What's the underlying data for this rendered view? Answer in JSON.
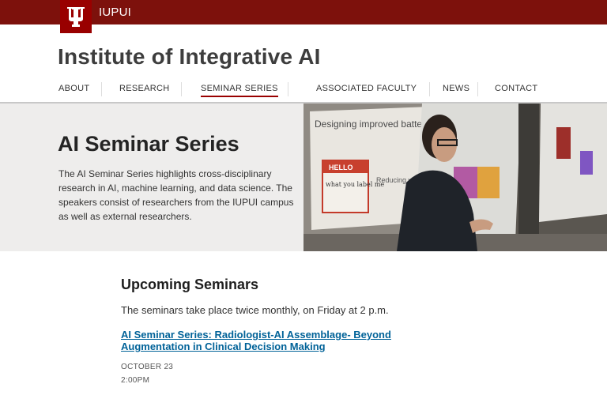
{
  "header": {
    "campus_name": "IUPUI",
    "brand_color": "#990000",
    "bar_color": "#7d110c",
    "logo_icon": "trident-icon"
  },
  "site": {
    "title": "Institute of Integrative AI"
  },
  "nav": {
    "items": [
      {
        "label": "ABOUT",
        "active": false
      },
      {
        "label": "RESEARCH",
        "active": false
      },
      {
        "label": "SEMINAR SERIES",
        "active": true
      },
      {
        "label": "ASSOCIATED FACULTY",
        "active": false
      },
      {
        "label": "NEWS",
        "active": false
      },
      {
        "label": "CONTACT",
        "active": false
      }
    ]
  },
  "hero": {
    "title": "AI Seminar Series",
    "text": "The AI Seminar Series highlights cross-disciplinary research in AI, machine learning, and data science. The speakers consist of researchers from the IUPUI campus as well as external researchers.",
    "photo": {
      "slide_title": "Designing improved batteries with nano-technology",
      "sticker_top": "HELLO",
      "sticker_hand": "what you label me",
      "slide_fragment": "Reducing w through u reflectio"
    }
  },
  "main": {
    "section_title": "Upcoming Seminars",
    "intro": "The seminars take place twice monthly, on Friday at 2 p.m.",
    "seminar": {
      "title": "AI Seminar Series: Radiologist-AI Assemblage- Beyond Augmentation in Clinical Decision Making",
      "date": "OCTOBER 23",
      "time": "2:00PM"
    }
  }
}
